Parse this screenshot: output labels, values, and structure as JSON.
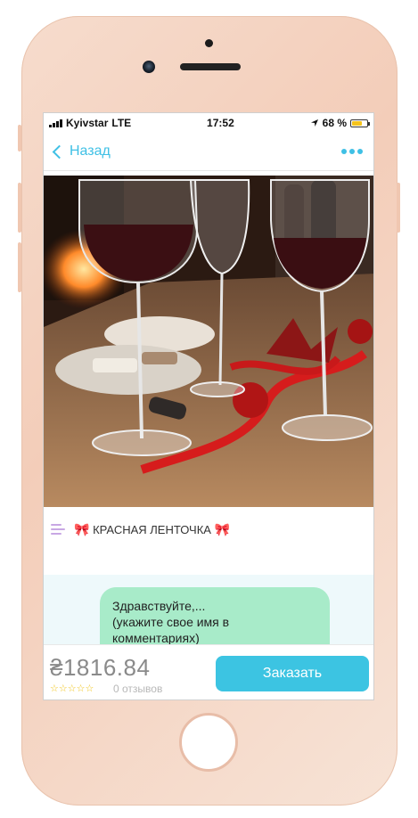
{
  "status_bar": {
    "carrier": "Kyivstar",
    "network": "LTE",
    "time": "17:52",
    "battery": "68 %",
    "battery_level": 0.68
  },
  "nav": {
    "back_label": "Назад"
  },
  "product": {
    "title": "КРАСНАЯ ЛЕНТОЧКА",
    "bow_left": "🎀",
    "bow_right": "🎀"
  },
  "chat": {
    "message": "Здравствуйте,...\n(укажите свое имя в\nкомментариях)"
  },
  "purchase": {
    "price": "₴1816.84",
    "stars": "☆☆☆☆☆",
    "reviews": "0 отзывов",
    "order_label": "Заказать"
  },
  "colors": {
    "accent": "#3cc4e2",
    "bubble": "#a8ebc9"
  }
}
